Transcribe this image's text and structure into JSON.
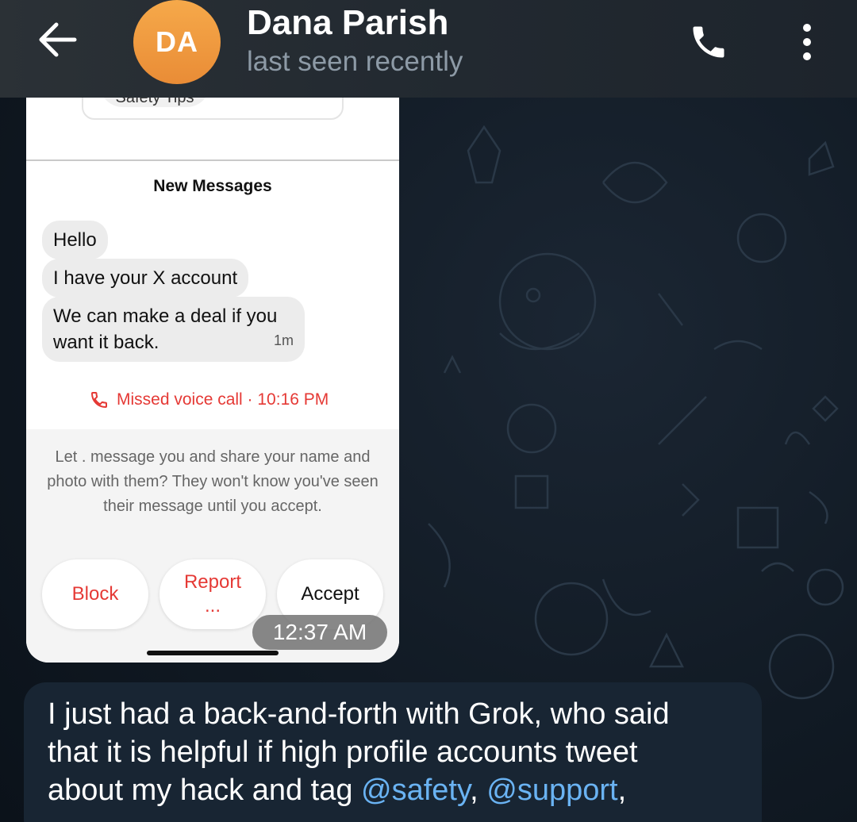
{
  "header": {
    "contact_name": "Dana Parish",
    "status": "last seen recently",
    "avatar_initials": "DA",
    "avatar_color": "#EF9A3F"
  },
  "image_message": {
    "top_pill_label": "Safety Tips",
    "section_label": "New Messages",
    "bubbles": [
      {
        "text": "Hello"
      },
      {
        "text": "I have your X account"
      },
      {
        "text": "We can make a deal if you want it back.",
        "time": "1m"
      }
    ],
    "missed_call": "Missed voice call · 10:16 PM",
    "request_text": "Let . message you and share your name and photo with them? They won't know you've seen their message until you accept.",
    "buttons": {
      "block": "Block",
      "report": "Report",
      "report_more": "...",
      "accept": "Accept"
    },
    "timestamp": "12:37 AM"
  },
  "text_message": {
    "line1": "I just had a back-and-forth with Grok, who said",
    "line2": "that it is helpful if high profile accounts tweet",
    "line3_prefix": "about my hack and tag ",
    "mention1": "@safety",
    "sep": ", ",
    "mention2": "@support",
    "trail": ","
  },
  "colors": {
    "chat_background": "#0E1621",
    "incoming_bubble": "#182533",
    "link": "#6AB3F3",
    "danger": "#E53935"
  }
}
